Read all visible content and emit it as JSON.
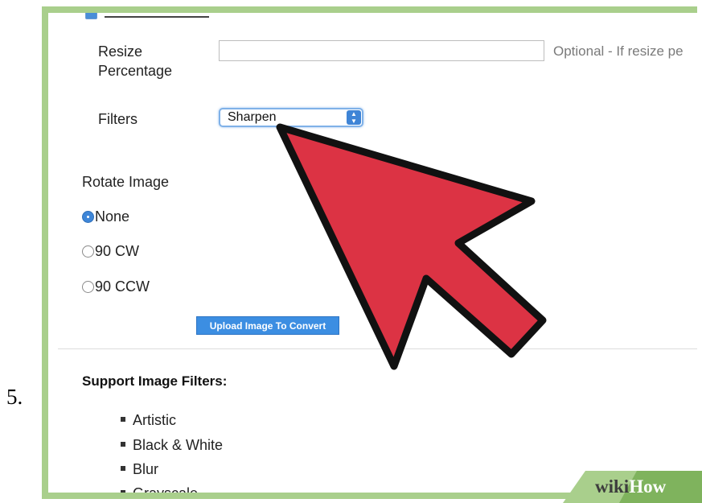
{
  "step_number": "5.",
  "form": {
    "resize_label": "Resize Percentage",
    "resize_value": "",
    "resize_hint": "Optional - If resize pe",
    "filters_label": "Filters",
    "filters_selected": "Sharpen",
    "rotate_label": "Rotate Image",
    "rotate_options": [
      {
        "label": "None",
        "checked": true
      },
      {
        "label": "90 CW",
        "checked": false
      },
      {
        "label": "90 CCW",
        "checked": false
      }
    ],
    "upload_button": "Upload Image To Convert"
  },
  "support": {
    "heading": "Support Image Filters:",
    "items": [
      "Artistic",
      "Black & White",
      "Blur",
      "Grayscale"
    ]
  },
  "watermark": {
    "wiki": "wiki",
    "how": "How"
  },
  "colors": {
    "frame": "#a9cf8c",
    "arrow_fill": "#dc3344",
    "accent_blue": "#3c8ee2"
  }
}
